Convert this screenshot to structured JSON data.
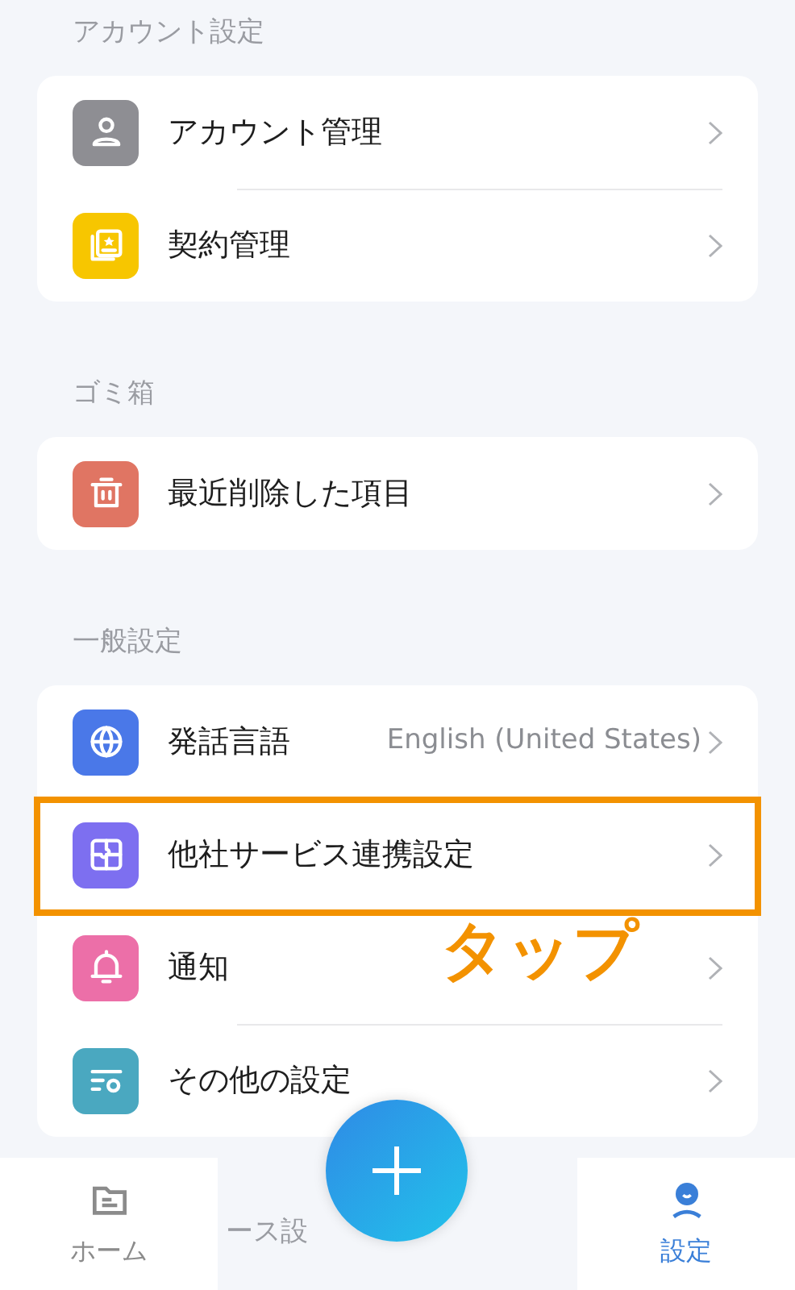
{
  "sections": [
    {
      "title": "アカウント設定",
      "items": [
        {
          "color": "#8e8e93",
          "label": "アカウント管理"
        },
        {
          "color": "#f7c600",
          "label": "契約管理"
        }
      ]
    },
    {
      "title": "ゴミ箱",
      "items": [
        {
          "color": "#e07563",
          "label": "最近削除した項目"
        }
      ]
    },
    {
      "title": "一般設定",
      "items": [
        {
          "color": "#4a78e8",
          "label": "発話言語",
          "value": "English (United States)"
        },
        {
          "color": "#7d6ff0",
          "label": "他社サービス連携設定",
          "highlighted": true
        },
        {
          "color": "#ec6fa8",
          "label": "通知"
        },
        {
          "color": "#4aa8c0",
          "label": "その他の設定"
        }
      ]
    },
    {
      "title": "ース設"
    }
  ],
  "annotation": {
    "text": "タップ"
  },
  "nav": [
    {
      "label": "ホーム",
      "selected": false
    },
    {
      "label": "設定",
      "selected": true
    }
  ]
}
